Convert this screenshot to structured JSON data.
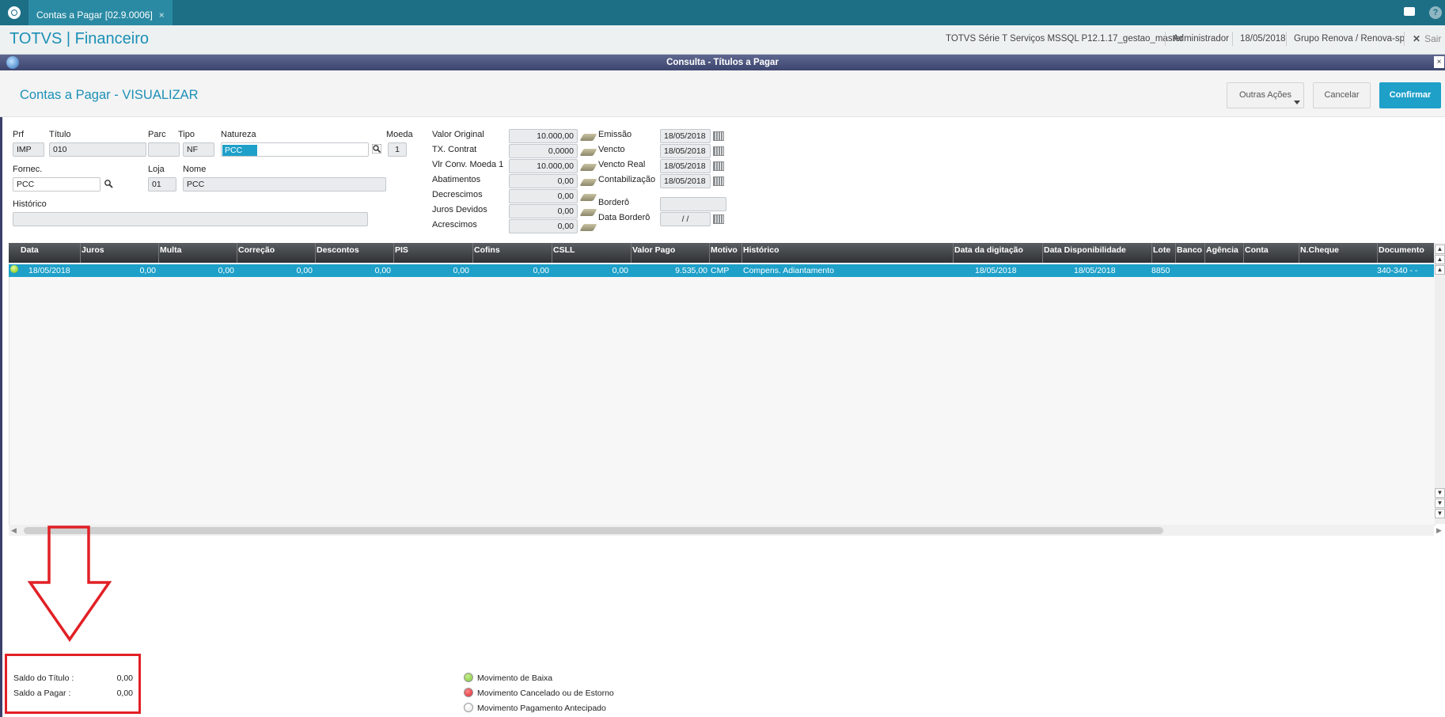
{
  "topbar": {
    "tab_label": "Contas a Pagar [02.9.0006]",
    "tab_close": "×"
  },
  "header": {
    "app_title": "TOTVS | Financeiro",
    "environment": "TOTVS Série T Serviços MSSQL P12.1.17_gestao_master",
    "user": "Administrador",
    "date": "18/05/2018",
    "company": "Grupo Renova / Renova-sp",
    "logout_label": "Sair",
    "logout_icon": "✕"
  },
  "dialog": {
    "title": "Consulta - Títulos a Pagar",
    "close": "×"
  },
  "page": {
    "title": "Contas a Pagar - VISUALIZAR",
    "other_actions": "Outras Ações",
    "cancel": "Cancelar",
    "confirm": "Confirmar"
  },
  "form": {
    "prf": {
      "label": "Prf",
      "value": "IMP"
    },
    "titulo": {
      "label": "Título",
      "value": "010"
    },
    "parc": {
      "label": "Parc",
      "value": ""
    },
    "tipo": {
      "label": "Tipo",
      "value": "NF"
    },
    "natureza": {
      "label": "Natureza",
      "value": "PCC"
    },
    "moeda": {
      "label": "Moeda",
      "value": "1"
    },
    "fornec": {
      "label": "Fornec.",
      "value": "PCC"
    },
    "loja": {
      "label": "Loja",
      "value": "01"
    },
    "nome": {
      "label": "Nome",
      "value": "PCC"
    },
    "historico": {
      "label": "Histórico",
      "value": ""
    },
    "valor_original": {
      "label": "Valor Original",
      "value": "10.000,00"
    },
    "tx_contrat": {
      "label": "TX. Contrat",
      "value": "0,0000"
    },
    "vlr_conv": {
      "label": "Vlr Conv. Moeda 1",
      "value": "10.000,00"
    },
    "abatimentos": {
      "label": "Abatimentos",
      "value": "0,00"
    },
    "decrescimos": {
      "label": "Decrescimos",
      "value": "0,00"
    },
    "juros_devidos": {
      "label": "Juros Devidos",
      "value": "0,00"
    },
    "acrescimos": {
      "label": "Acrescimos",
      "value": "0,00"
    },
    "emissao": {
      "label": "Emissão",
      "value": "18/05/2018"
    },
    "vencto": {
      "label": "Vencto",
      "value": "18/05/2018"
    },
    "vencto_real": {
      "label": "Vencto Real",
      "value": "18/05/2018"
    },
    "contabilizacao": {
      "label": "Contabilização",
      "value": "18/05/2018"
    },
    "bordero": {
      "label": "Borderô",
      "value": ""
    },
    "data_bordero": {
      "label": "Data Borderô",
      "value": " / /"
    }
  },
  "grid": {
    "headers": [
      "Data",
      "Juros",
      "Multa",
      "Correção",
      "Descontos",
      "PIS",
      "Cofins",
      "CSLL",
      "Valor Pago",
      "Motivo",
      "Histórico",
      "Data da digitação",
      "Data Disponibilidade",
      "Lote",
      "Banco",
      "Agência",
      "Conta",
      "N.Cheque",
      "Documento"
    ],
    "row": {
      "data": "18/05/2018",
      "juros": "0,00",
      "multa": "0,00",
      "correcao": "0,00",
      "descontos": "0,00",
      "pis": "0,00",
      "cofins": "0,00",
      "csll": "0,00",
      "valor_pago": "9.535,00",
      "motivo": "CMP",
      "historico": "Compens. Adiantamento",
      "data_digitacao": "18/05/2018",
      "data_disponibilidade": "18/05/2018",
      "lote": "8850",
      "banco": "",
      "agencia": "",
      "conta": "",
      "n_cheque": "",
      "documento": "340-340   -   -"
    }
  },
  "summary": {
    "saldo_titulo_label": "Saldo do Título :",
    "saldo_titulo_value": "0,00",
    "saldo_pagar_label": "Saldo a Pagar  :",
    "saldo_pagar_value": "0,00"
  },
  "legend": [
    {
      "label": "Movimento de Baixa",
      "color": "#7cc242"
    },
    {
      "label": "Movimento Cancelado ou de Estorno",
      "color": "#d9232e"
    },
    {
      "label": "Movimento Pagamento Antecipado",
      "color": "#e6e6e6"
    }
  ],
  "colors": {
    "accent": "#1b90b5",
    "highlight": "#e12025",
    "topbar": "#1d6f86"
  }
}
